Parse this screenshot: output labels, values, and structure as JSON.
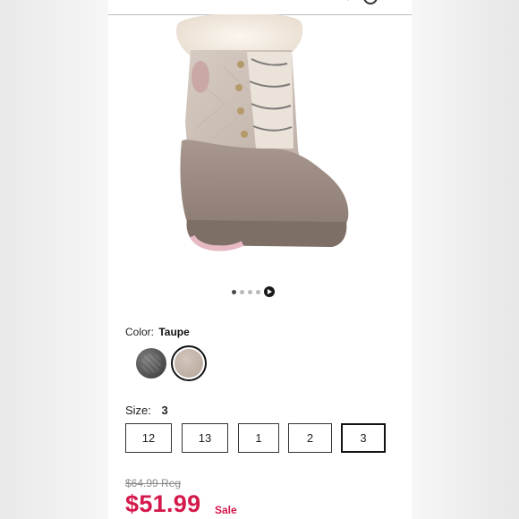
{
  "product": {
    "color_label": "Color:",
    "color_value": "Taupe",
    "size_label": "Size:",
    "size_value": "3",
    "sizes": [
      "12",
      "13",
      "1",
      "2",
      "3"
    ],
    "selected_size": "3",
    "colors": [
      "charcoal",
      "taupe"
    ],
    "selected_color": "taupe"
  },
  "carousel": {
    "dots": 4,
    "active_dot": 1,
    "video_icon": "play-icon"
  },
  "price": {
    "original": "$64.99 Reg",
    "sale": "$51.99",
    "sale_label": "Sale",
    "sale_color": "#d4184b"
  }
}
